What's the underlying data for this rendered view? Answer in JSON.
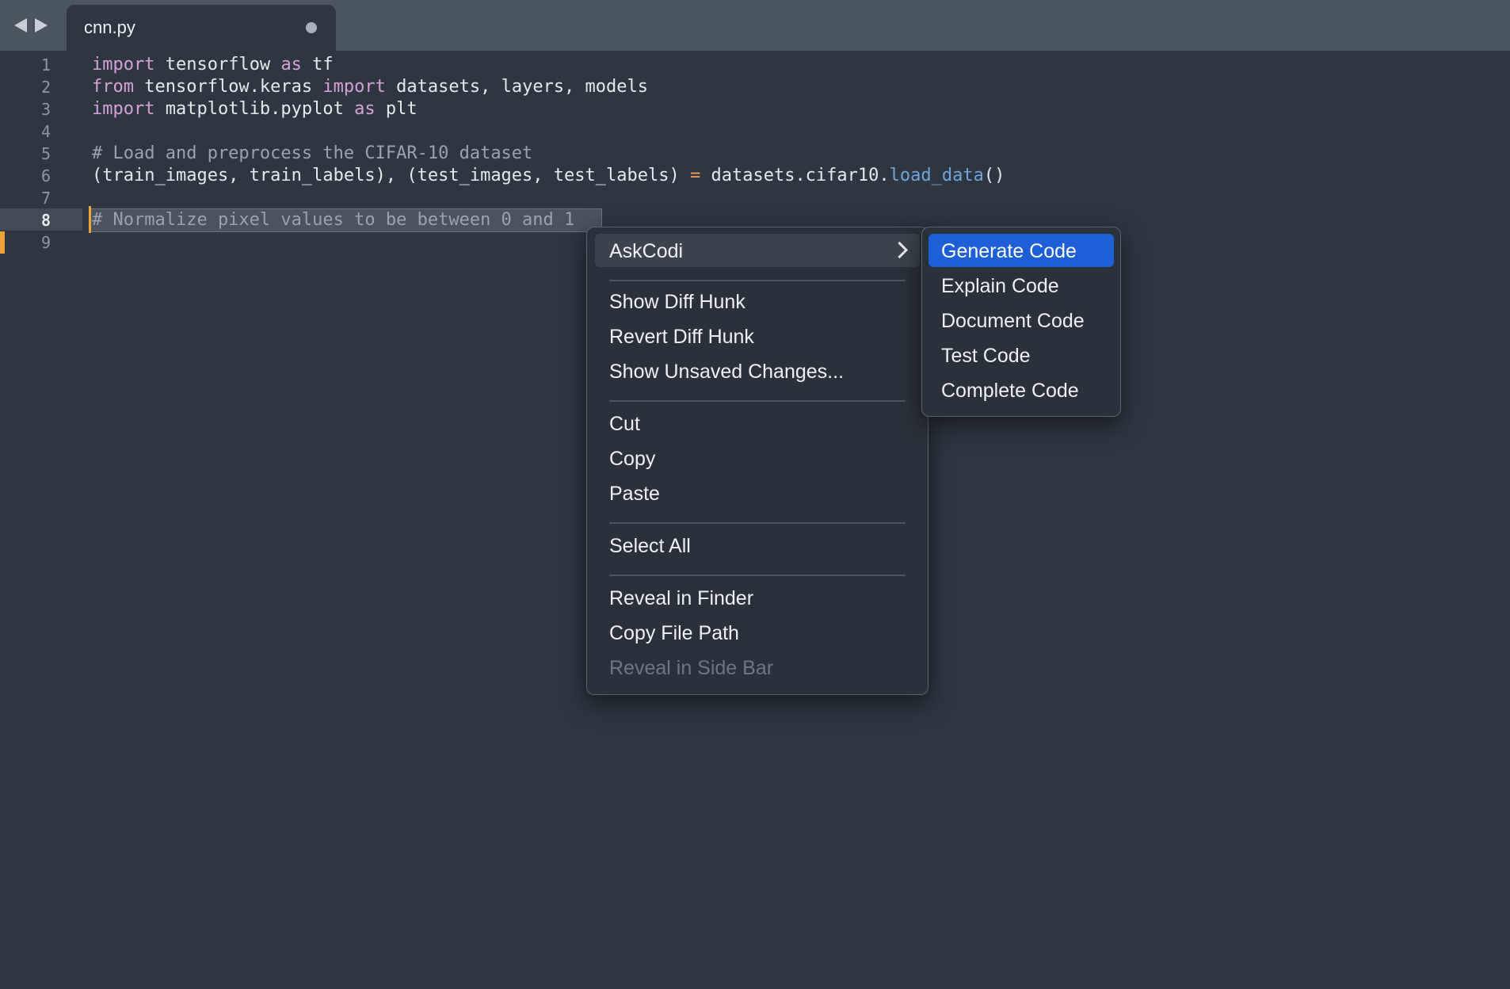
{
  "tab": {
    "title": "cnn.py"
  },
  "editor": {
    "line_numbers": [
      "1",
      "2",
      "3",
      "4",
      "5",
      "6",
      "7",
      "8",
      "9"
    ],
    "active_line": "8",
    "lines": [
      {
        "parts": [
          {
            "t": "import",
            "c": "kw"
          },
          {
            "t": " tensorflow ",
            "c": ""
          },
          {
            "t": "as",
            "c": "kw"
          },
          {
            "t": " tf",
            "c": ""
          }
        ]
      },
      {
        "parts": [
          {
            "t": "from",
            "c": "kw"
          },
          {
            "t": " tensorflow.keras ",
            "c": ""
          },
          {
            "t": "import",
            "c": "kw"
          },
          {
            "t": " datasets, layers, models",
            "c": ""
          }
        ]
      },
      {
        "parts": [
          {
            "t": "import",
            "c": "kw"
          },
          {
            "t": " matplotlib.pyplot ",
            "c": ""
          },
          {
            "t": "as",
            "c": "kw"
          },
          {
            "t": " plt",
            "c": ""
          }
        ]
      },
      {
        "parts": []
      },
      {
        "parts": [
          {
            "t": "# Load and preprocess the CIFAR-10 dataset",
            "c": "cm"
          }
        ]
      },
      {
        "parts": [
          {
            "t": "(train_images, train_labels), (test_images, test_labels) ",
            "c": ""
          },
          {
            "t": "=",
            "c": "op"
          },
          {
            "t": " datasets.cifar10.",
            "c": ""
          },
          {
            "t": "load_data",
            "c": "fn"
          },
          {
            "t": "()",
            "c": ""
          }
        ]
      },
      {
        "parts": []
      },
      {
        "parts": [
          {
            "t": "# Normalize pixel values to be between 0 and 1",
            "c": "cm"
          }
        ]
      },
      {
        "parts": []
      }
    ]
  },
  "context_menu": {
    "askcodi": "AskCodi",
    "show_diff_hunk": "Show Diff Hunk",
    "revert_diff_hunk": "Revert Diff Hunk",
    "show_unsaved_changes": "Show Unsaved Changes...",
    "cut": "Cut",
    "copy": "Copy",
    "paste": "Paste",
    "select_all": "Select All",
    "reveal_in_finder": "Reveal in Finder",
    "copy_file_path": "Copy File Path",
    "reveal_in_side_bar": "Reveal in Side Bar"
  },
  "askcodi_submenu": {
    "generate_code": "Generate Code",
    "explain_code": "Explain Code",
    "document_code": "Document Code",
    "test_code": "Test Code",
    "complete_code": "Complete Code"
  },
  "colors": {
    "editor_bg": "#2e3641",
    "tabbar_bg": "#4b5461",
    "keyword": "#d8a0d8",
    "comment": "#9aa3ad",
    "function": "#6fa6dc",
    "operator": "#f09a5a",
    "selected_menu_item": "#1e5fd6",
    "caret": "#f0a43a"
  }
}
